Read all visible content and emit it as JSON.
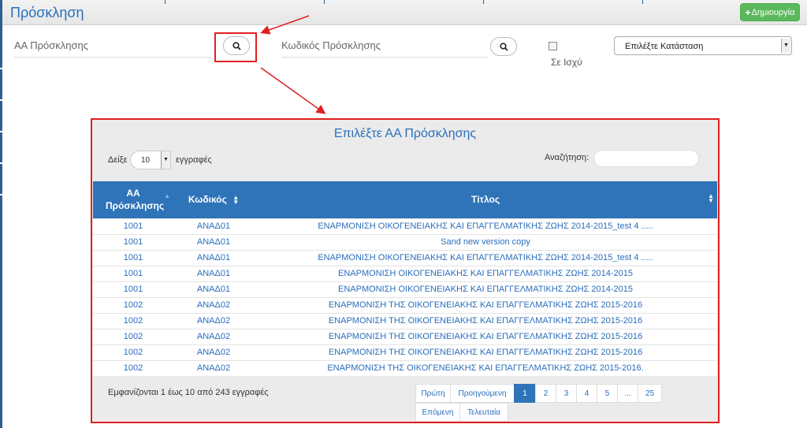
{
  "header": {
    "title": "Πρόσκληση",
    "create_label": "Δημιουργία"
  },
  "filters": {
    "aa_label": "ΑΑ Πρόσκλησης",
    "code_label": "Κωδικός Πρόσκλησης",
    "in_force_label": "Σε Ισχύ",
    "status_placeholder": "Επιλέξτε Κατάσταση"
  },
  "modal": {
    "title": "Επιλέξτε ΑΑ Πρόσκλησης",
    "show_label": "Δείξε",
    "page_length": "10",
    "records_label": "εγγραφές",
    "search_label": "Αναζήτηση:",
    "columns": {
      "aa": "ΑΑ Πρόσκλησης",
      "code": "Κωδικός",
      "title": "Τίτλος"
    },
    "rows": [
      {
        "aa": "1001",
        "code": "ΑΝΑΔ01",
        "title": "ΕΝΑΡΜΟΝΙΣΗ ΟΙΚΟΓΕΝΕΙΑΚΗΣ ΚΑΙ ΕΠΑΓΓΕΛΜΑΤΙΚΗΣ ΖΩΗΣ 2014-2015_test 4 ....."
      },
      {
        "aa": "1001",
        "code": "ΑΝΑΔ01",
        "title": "Sand new version copy"
      },
      {
        "aa": "1001",
        "code": "ΑΝΑΔ01",
        "title": "ΕΝΑΡΜΟΝΙΣΗ ΟΙΚΟΓΕΝΕΙΑΚΗΣ ΚΑΙ ΕΠΑΓΓΕΛΜΑΤΙΚΗΣ ΖΩΗΣ 2014-2015_test 4 ....."
      },
      {
        "aa": "1001",
        "code": "ΑΝΑΔ01",
        "title": "ΕΝΑΡΜΟΝΙΣΗ ΟΙΚΟΓΕΝΕΙΑΚΗΣ ΚΑΙ ΕΠΑΓΓΕΛΜΑΤΙΚΗΣ ΖΩΗΣ 2014-2015"
      },
      {
        "aa": "1001",
        "code": "ΑΝΑΔ01",
        "title": "ΕΝΑΡΜΟΝΙΣΗ ΟΙΚΟΓΕΝΕΙΑΚΗΣ ΚΑΙ ΕΠΑΓΓΕΛΜΑΤΙΚΗΣ ΖΩΗΣ 2014-2015"
      },
      {
        "aa": "1002",
        "code": "ΑΝΑΔ02",
        "title": "ΕΝΑΡΜΟΝΙΣΗ ΤΗΣ ΟΙΚΟΓΕΝΕΙΑΚΗΣ ΚΑΙ ΕΠΑΓΓΕΛΜΑΤΙΚΗΣ ΖΩΗΣ 2015-2016"
      },
      {
        "aa": "1002",
        "code": "ΑΝΑΔ02",
        "title": "ΕΝΑΡΜΟΝΙΣΗ ΤΗΣ ΟΙΚΟΓΕΝΕΙΑΚΗΣ ΚΑΙ ΕΠΑΓΓΕΛΜΑΤΙΚΗΣ ΖΩΗΣ 2015-2016"
      },
      {
        "aa": "1002",
        "code": "ΑΝΑΔ02",
        "title": "ΕΝΑΡΜΟΝΙΣΗ ΤΗΣ ΟΙΚΟΓΕΝΕΙΑΚΗΣ ΚΑΙ ΕΠΑΓΓΕΛΜΑΤΙΚΗΣ ΖΩΗΣ 2015-2016"
      },
      {
        "aa": "1002",
        "code": "ΑΝΑΔ02",
        "title": "ΕΝΑΡΜΟΝΙΣΗ ΤΗΣ ΟΙΚΟΓΕΝΕΙΑΚΗΣ ΚΑΙ ΕΠΑΓΓΕΛΜΑΤΙΚΗΣ ΖΩΗΣ 2015-2016"
      },
      {
        "aa": "1002",
        "code": "ΑΝΑΔ02",
        "title": "ΕΝΑΡΜΟΝΙΣΗ ΤΗΣ ΟΙΚΟΓΕΝΕΙΑΚΗΣ ΚΑΙ ΕΠΑΓΓΕΛΜΑΤΙΚΗΣ ΖΩΗΣ 2015-2016."
      }
    ],
    "info": "Εμφανίζονται 1 έως 10 από 243 εγγραφές",
    "pager": {
      "first": "Πρώτη",
      "previous": "Προηγούμενη",
      "pages": [
        "1",
        "2",
        "3",
        "4",
        "5",
        "...",
        "25"
      ],
      "next": "Επόμενη",
      "last": "Τελευταία"
    }
  },
  "colors": {
    "accent": "#2a6ebb",
    "table_header": "#2f74b8",
    "create_button": "#5cb85c",
    "highlight": "#e02020"
  }
}
